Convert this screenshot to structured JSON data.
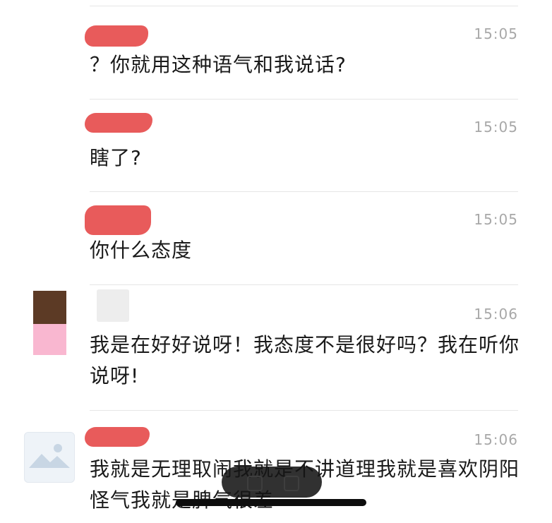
{
  "messages": [
    {
      "time": "15:05",
      "text": "？你就用这种语气和我说话?"
    },
    {
      "time": "15:05",
      "text": "瞎了?"
    },
    {
      "time": "15:05",
      "text": "你什么态度"
    },
    {
      "time": "15:06",
      "text": "我是在好好说呀！我态度不是很好吗？我在听你说呀!"
    },
    {
      "time": "15:06",
      "text": "我就是无理取闹我就是不讲道理我就是喜欢阴阳怪气我就是脾气很差"
    }
  ],
  "colors": {
    "redaction": "#e85b5b",
    "timestamp": "#a8a8a8",
    "divider": "#e6e6e6",
    "avatar_brown": "#5c3a25",
    "avatar_pink": "#f9b7d0"
  },
  "icons": {
    "avatar_landscape": "landscape-placeholder-icon"
  }
}
